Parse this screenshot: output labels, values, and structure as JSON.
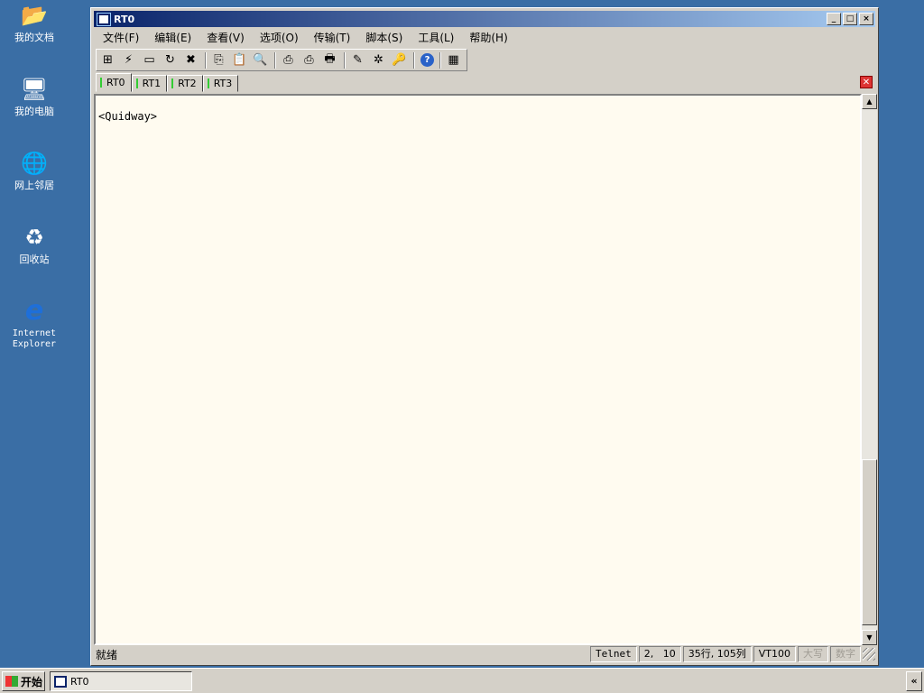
{
  "desktop": {
    "icons": [
      {
        "label": "我的文档",
        "glyph": "📂",
        "icon": "my-documents-icon"
      },
      {
        "label": "我的电脑",
        "glyph": "🖥",
        "icon": "my-computer-icon"
      },
      {
        "label": "网上邻居",
        "glyph": "🌐",
        "icon": "network-places-icon"
      },
      {
        "label": "回收站",
        "glyph": "♻",
        "icon": "recycle-bin-icon"
      },
      {
        "label": "Internet Explorer",
        "glyph": "e",
        "icon": "internet-explorer-icon"
      }
    ]
  },
  "window": {
    "title": "RT0",
    "minimize": "_",
    "maximize": "□",
    "close": "×"
  },
  "menu": [
    "文件(F)",
    "编辑(E)",
    "查看(V)",
    "选项(O)",
    "传输(T)",
    "脚本(S)",
    "工具(L)",
    "帮助(H)"
  ],
  "toolbar": [
    {
      "icon": "connect-icon",
      "glyph": "⊞"
    },
    {
      "icon": "quick-connect-icon",
      "glyph": "⚡"
    },
    {
      "icon": "connect-tab-icon",
      "glyph": "▭"
    },
    {
      "icon": "reconnect-icon",
      "glyph": "↻"
    },
    {
      "icon": "disconnect-icon",
      "glyph": "✖"
    },
    {
      "sep": true
    },
    {
      "icon": "copy-icon",
      "glyph": "⎘"
    },
    {
      "icon": "paste-icon",
      "glyph": "📋"
    },
    {
      "icon": "find-icon",
      "glyph": "🔍"
    },
    {
      "sep": true
    },
    {
      "icon": "print-screen-icon",
      "glyph": "⎙"
    },
    {
      "icon": "print-selection-icon",
      "glyph": "⎙"
    },
    {
      "icon": "print-icon",
      "glyph": "🖶"
    },
    {
      "sep": true
    },
    {
      "icon": "session-options-icon",
      "glyph": "✎"
    },
    {
      "icon": "sftp-icon",
      "glyph": "✲"
    },
    {
      "icon": "keymap-icon",
      "glyph": "🔑"
    },
    {
      "sep": true
    },
    {
      "icon": "help-icon",
      "glyph": "?"
    },
    {
      "sep": true
    },
    {
      "icon": "toolbar-options-icon",
      "glyph": "▦"
    }
  ],
  "tabs": [
    "RT0",
    "RT1",
    "RT2",
    "RT3"
  ],
  "terminal": {
    "text": "<Quidway>"
  },
  "status": {
    "ready": "就绪",
    "protocol": "Telnet",
    "cursor": "2,   10",
    "size": "35行, 105列",
    "emulation": "VT100",
    "caps": "大写",
    "num": "数字"
  },
  "taskbar": {
    "start": "开始",
    "task": "RT0",
    "tray": "«"
  }
}
